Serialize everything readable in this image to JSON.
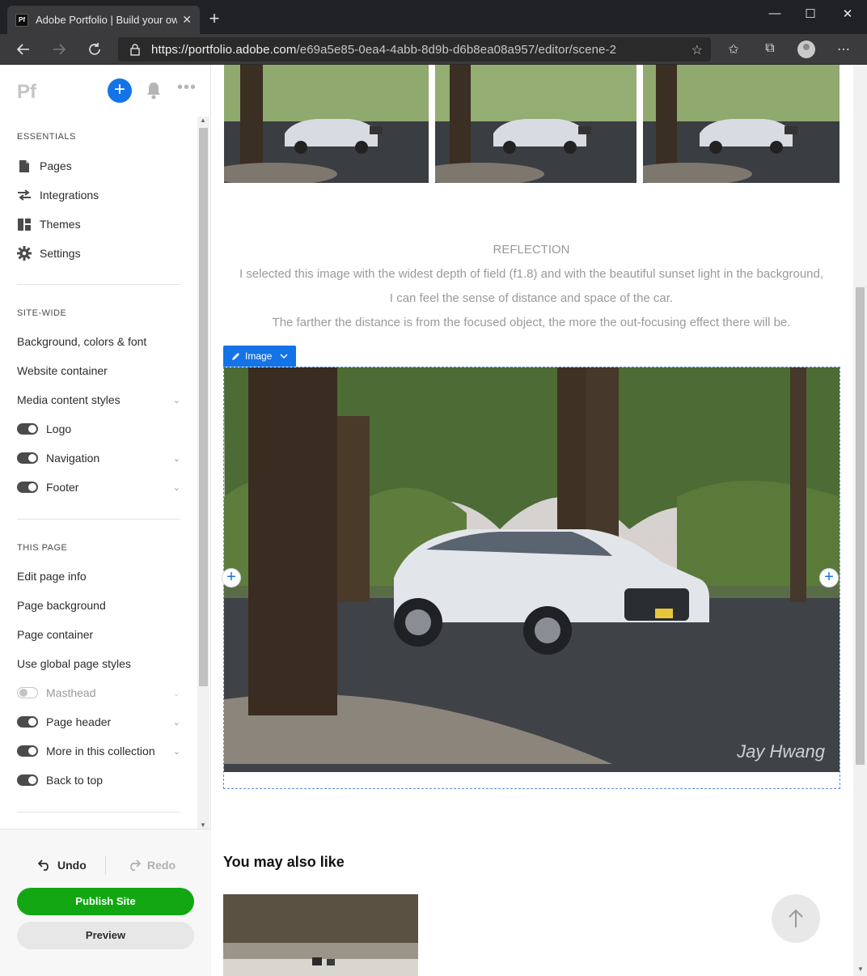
{
  "browser": {
    "tab_favicon": "Pf",
    "tab_title": "Adobe Portfolio | Build your own",
    "tab_close": "✕",
    "new_tab": "+",
    "url_host": "https://portfolio.adobe.com",
    "url_path": "/e69a5e85-0ea4-4abb-8d9b-d6b8ea08a957/editor/scene-2",
    "minimize": "—",
    "maximize": "☐",
    "close": "✕"
  },
  "sidebar": {
    "logo": "Pf",
    "add": "+",
    "more": "•••",
    "essentials_heading": "ESSENTIALS",
    "essentials": [
      {
        "label": "Pages",
        "icon": "page-icon"
      },
      {
        "label": "Integrations",
        "icon": "integrations-icon"
      },
      {
        "label": "Themes",
        "icon": "themes-icon"
      },
      {
        "label": "Settings",
        "icon": "gear-icon"
      }
    ],
    "sitewide_heading": "SITE-WIDE",
    "sitewide": {
      "background": "Background, colors & font",
      "website_container": "Website container",
      "media_styles": "Media content styles",
      "logo": "Logo",
      "navigation": "Navigation",
      "footer": "Footer"
    },
    "thispage_heading": "THIS PAGE",
    "thispage": {
      "edit_info": "Edit page info",
      "page_background": "Page background",
      "page_container": "Page container",
      "global_styles": "Use global page styles",
      "masthead": "Masthead",
      "page_header": "Page header",
      "more_collection": "More in this collection",
      "back_to_top": "Back to top"
    },
    "undo": "Undo",
    "redo": "Redo",
    "publish": "Publish Site",
    "preview": "Preview"
  },
  "main": {
    "reflection_title": "REFLECTION",
    "reflection_lines": [
      "I selected this image with the widest depth of field (f1.8) and with the beautiful sunset light in the background,",
      "I can feel the sense of distance and space of the car.",
      "The farther the distance is from the focused object, the more the out-focusing effect there will be."
    ],
    "image_chip": "Image",
    "watermark": "Jay Hwang",
    "also_like": "You may also like",
    "plus": "+"
  },
  "colors": {
    "accent": "#1473e6",
    "publish": "#12a712"
  }
}
